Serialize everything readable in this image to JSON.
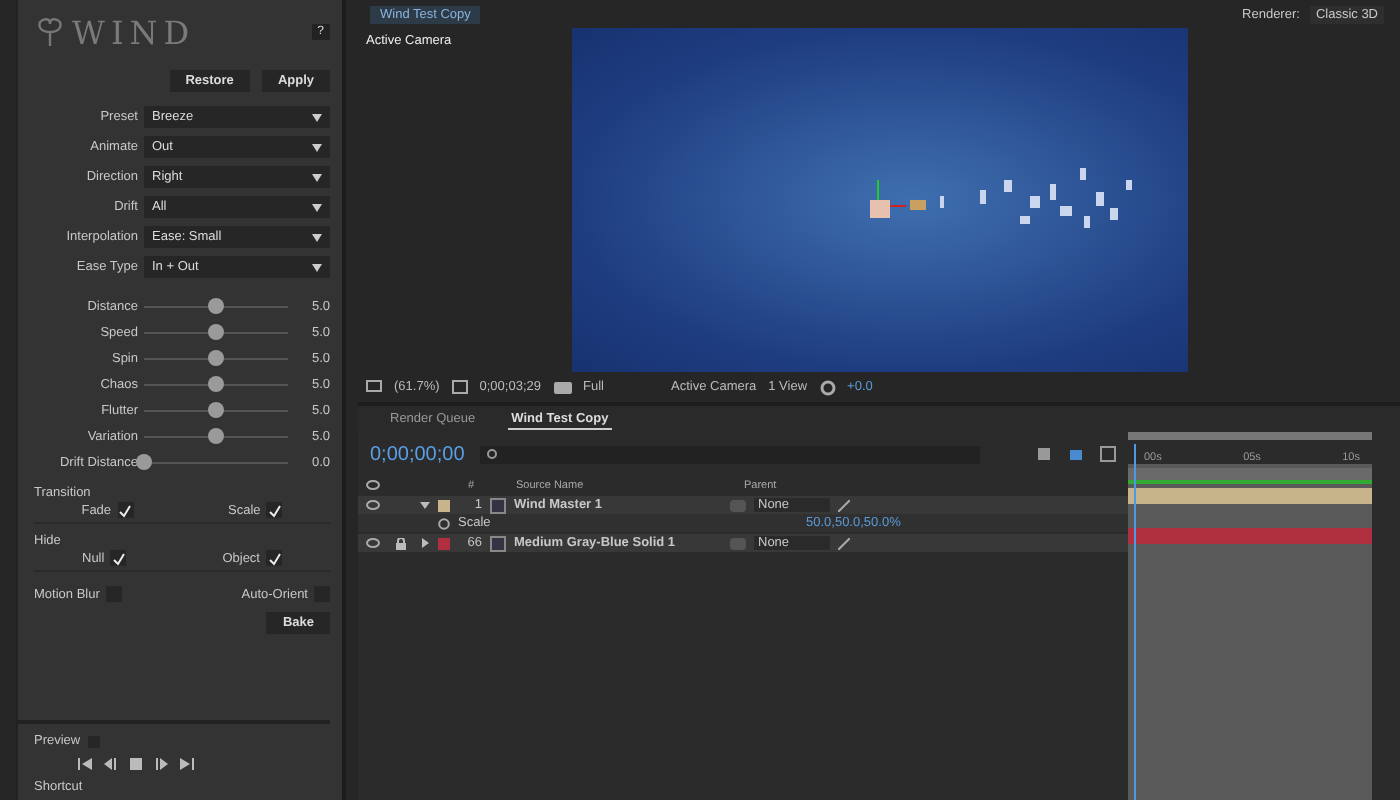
{
  "wind_panel": {
    "logo": "WIND",
    "help": "?",
    "buttons": [
      "Restore",
      "Apply"
    ],
    "dropdowns": [
      {
        "label": "Preset",
        "value": "Breeze"
      },
      {
        "label": "Animate",
        "value": "Out"
      },
      {
        "label": "Direction",
        "value": "Right"
      },
      {
        "label": "Drift",
        "value": "All"
      },
      {
        "label": "Interpolation",
        "value": "Ease: Small"
      },
      {
        "label": "Ease Type",
        "value": "In + Out"
      }
    ],
    "sliders": [
      {
        "label": "Distance",
        "level": 0.5,
        "reading": "5.0"
      },
      {
        "label": "Speed",
        "level": 0.5,
        "reading": "5.0"
      },
      {
        "label": "Spin",
        "level": 0.5,
        "reading": "5.0"
      },
      {
        "label": "Chaos",
        "level": 0.5,
        "reading": "5.0"
      },
      {
        "label": "Flutter",
        "level": 0.5,
        "reading": "5.0"
      },
      {
        "label": "Variation",
        "level": 0.5,
        "reading": "5.0"
      },
      {
        "label": "Drift Distance",
        "level": 0,
        "reading": "0.0"
      }
    ],
    "sections": [
      {
        "title": "Transition",
        "checkboxes": [
          {
            "label": "Fade",
            "checked": true
          },
          {
            "label": "Scale",
            "checked": true
          }
        ]
      },
      {
        "title": "Hide",
        "checkboxes": [
          {
            "label": "Null",
            "checked": true
          },
          {
            "label": "Object",
            "checked": true
          }
        ]
      }
    ],
    "options": [
      {
        "label": "Motion Blur",
        "checked": false
      },
      {
        "label": "Auto-Orient",
        "checked": false
      }
    ],
    "bake_button": "Bake",
    "preview": {
      "label": "Preview",
      "checked": false
    },
    "shortcut": "Shortcut"
  },
  "viewer": {
    "tab": "Wind Test Copy",
    "renderer_label": "Renderer:",
    "renderer": "Classic 3D",
    "camera_label": "Active Camera",
    "toolbar": {
      "zoom": "(61.7%)",
      "timecode": "0;00;03;29",
      "resolution": "Full",
      "camera": "Active Camera",
      "views": "1 View",
      "exposure": "+0.0"
    }
  },
  "timeline": {
    "tabs": [
      {
        "label": "Render Queue",
        "selected": false
      },
      {
        "label": "Wind Test Copy",
        "selected": true
      }
    ],
    "timecode": "0;00;00;00",
    "columns": {
      "number": "#",
      "source": "Source Name",
      "parent": "Parent"
    },
    "ruler": [
      "00s",
      "05s",
      "10s"
    ],
    "layers": [
      {
        "number": "1",
        "name": "Wind Master 1",
        "color": "#c8b48a",
        "expanded": true,
        "locked": false,
        "parent": "None",
        "property": {
          "name": "Scale",
          "value": "50.0,50.0,50.0%"
        }
      },
      {
        "number": "66",
        "name": "Medium Gray-Blue Solid 1",
        "color": "#b03040",
        "expanded": false,
        "locked": true,
        "parent": "None"
      }
    ]
  }
}
